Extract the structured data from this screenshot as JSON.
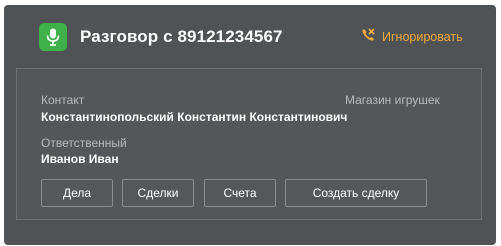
{
  "header": {
    "title_prefix": "Разговор с",
    "phone": "89121234567",
    "ignore_label": "Игнорировать",
    "icons": {
      "mic": "microphone-icon",
      "ignore": "phone-hangup-icon"
    }
  },
  "details": {
    "contact_label": "Контакт",
    "contact_name": "Константинопольский Константин Константинович",
    "company": "Магазин игрушек",
    "responsible_label": "Ответственный",
    "responsible_name": "Иванов Иван"
  },
  "actions": {
    "deals_tasks": "Дела",
    "deals": "Сделки",
    "invoices": "Счета",
    "create_deal": "Создать сделку"
  },
  "colors": {
    "card_background": "#4f5356",
    "accent_green": "#3fb04a",
    "accent_orange": "#f4a93a"
  }
}
